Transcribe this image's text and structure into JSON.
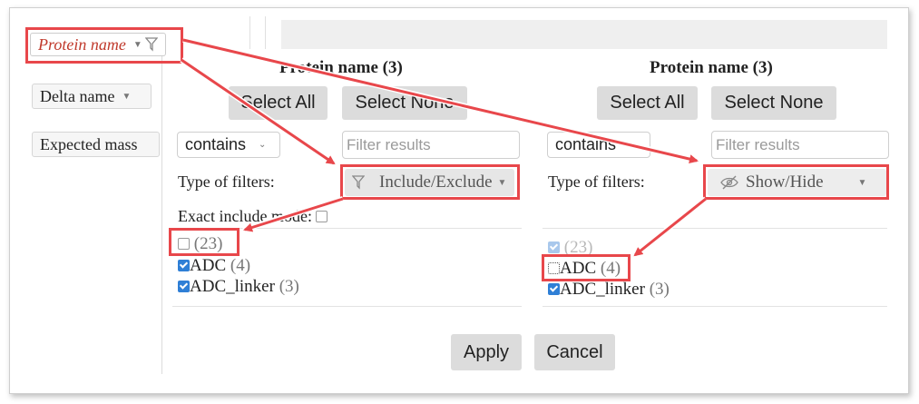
{
  "sidebar": {
    "columns": [
      {
        "label": "Protein name",
        "active": true
      },
      {
        "label": "Delta name"
      },
      {
        "label": "Expected mass"
      }
    ]
  },
  "left_panel": {
    "title": "Protein name (3)",
    "select_all": "Select All",
    "select_none": "Select None",
    "match_mode": "contains",
    "filter_placeholder": "Filter results",
    "type_label": "Type of filters:",
    "type_value": "Include/Exclude",
    "exact_label": "Exact include mode:",
    "items": [
      {
        "label": "",
        "count": "(23)",
        "checked": false
      },
      {
        "label": "ADC",
        "count": "(4)",
        "checked": true
      },
      {
        "label": "ADC_linker",
        "count": "(3)",
        "checked": true
      }
    ]
  },
  "right_panel": {
    "title": "Protein name (3)",
    "select_all": "Select All",
    "select_none": "Select None",
    "match_mode": "contains",
    "filter_placeholder": "Filter results",
    "type_label": "Type of filters:",
    "type_value": "Show/Hide",
    "items": [
      {
        "label": "",
        "count": "(23)",
        "checked": true
      },
      {
        "label": "ADC",
        "count": "(4)",
        "checked": false
      },
      {
        "label": "ADC_linker",
        "count": "(3)",
        "checked": true
      }
    ]
  },
  "footer": {
    "apply": "Apply",
    "cancel": "Cancel"
  },
  "colors": {
    "highlight": "#e8474b",
    "checkbox": "#2f7fd6",
    "active_column_text": "#c0392b"
  }
}
